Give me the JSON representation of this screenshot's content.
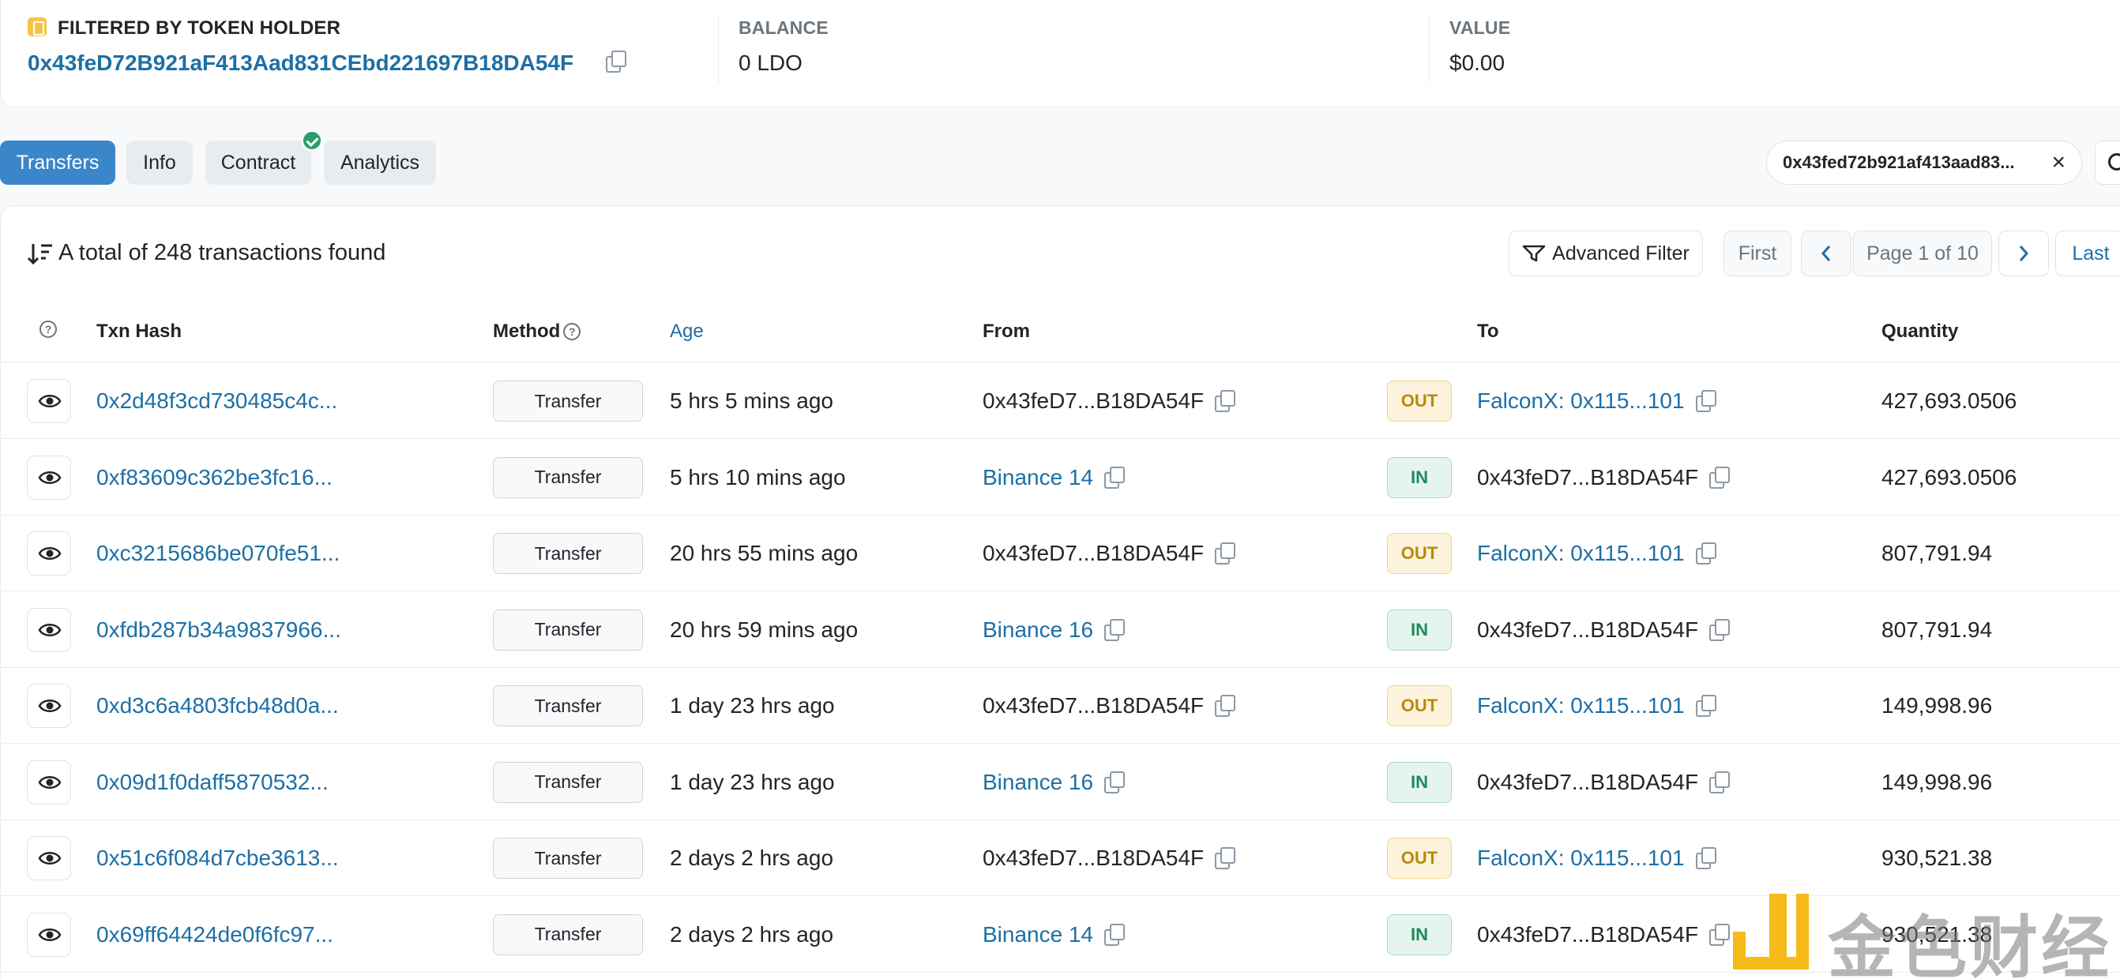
{
  "summary": {
    "filter_label": "FILTERED BY TOKEN HOLDER",
    "holder_address": "0x43feD72B921aF413Aad831CEbd221697B18DA54F",
    "balance_label": "BALANCE",
    "balance_value": "0 LDO",
    "value_label": "VALUE",
    "value_value": "$0.00"
  },
  "tabs": [
    {
      "label": "Transfers",
      "active": true
    },
    {
      "label": "Info",
      "active": false
    },
    {
      "label": "Contract",
      "active": false,
      "verified": true
    },
    {
      "label": "Analytics",
      "active": false
    }
  ],
  "filter_chip": {
    "text": "0x43fed72b921af413aad83..."
  },
  "toolbar": {
    "total_text": "A total of 248 transactions found",
    "advanced_filter_label": "Advanced Filter",
    "pagination": {
      "first": "First",
      "page_text": "Page 1 of 10",
      "last": "Last"
    }
  },
  "table": {
    "headers": {
      "txn_hash": "Txn Hash",
      "method": "Method",
      "age": "Age",
      "from": "From",
      "to": "To",
      "quantity": "Quantity"
    },
    "rows": [
      {
        "hash": "0x2d48f3cd730485c4c...",
        "method": "Transfer",
        "age": "5 hrs 5 mins ago",
        "from": "0x43feD7...B18DA54F",
        "from_link": false,
        "direction": "OUT",
        "to": "FalconX: 0x115...101",
        "to_link": true,
        "quantity": "427,693.0506"
      },
      {
        "hash": "0xf83609c362be3fc16...",
        "method": "Transfer",
        "age": "5 hrs 10 mins ago",
        "from": "Binance 14",
        "from_link": true,
        "direction": "IN",
        "to": "0x43feD7...B18DA54F",
        "to_link": false,
        "quantity": "427,693.0506"
      },
      {
        "hash": "0xc3215686be070fe51...",
        "method": "Transfer",
        "age": "20 hrs 55 mins ago",
        "from": "0x43feD7...B18DA54F",
        "from_link": false,
        "direction": "OUT",
        "to": "FalconX: 0x115...101",
        "to_link": true,
        "quantity": "807,791.94"
      },
      {
        "hash": "0xfdb287b34a9837966...",
        "method": "Transfer",
        "age": "20 hrs 59 mins ago",
        "from": "Binance 16",
        "from_link": true,
        "direction": "IN",
        "to": "0x43feD7...B18DA54F",
        "to_link": false,
        "quantity": "807,791.94"
      },
      {
        "hash": "0xd3c6a4803fcb48d0a...",
        "method": "Transfer",
        "age": "1 day 23 hrs ago",
        "from": "0x43feD7...B18DA54F",
        "from_link": false,
        "direction": "OUT",
        "to": "FalconX: 0x115...101",
        "to_link": true,
        "quantity": "149,998.96"
      },
      {
        "hash": "0x09d1f0daff5870532...",
        "method": "Transfer",
        "age": "1 day 23 hrs ago",
        "from": "Binance 16",
        "from_link": true,
        "direction": "IN",
        "to": "0x43feD7...B18DA54F",
        "to_link": false,
        "quantity": "149,998.96"
      },
      {
        "hash": "0x51c6f084d7cbe3613...",
        "method": "Transfer",
        "age": "2 days 2 hrs ago",
        "from": "0x43feD7...B18DA54F",
        "from_link": false,
        "direction": "OUT",
        "to": "FalconX: 0x115...101",
        "to_link": true,
        "quantity": "930,521.38"
      },
      {
        "hash": "0x69ff64424de0f6fc97...",
        "method": "Transfer",
        "age": "2 days 2 hrs ago",
        "from": "Binance 14",
        "from_link": true,
        "direction": "IN",
        "to": "0x43feD7...B18DA54F",
        "to_link": false,
        "quantity": "930,521.38"
      }
    ]
  },
  "watermark": {
    "text": "金色财经"
  },
  "colors": {
    "accent": "#3a86c8",
    "link": "#1d6fa5",
    "out_badge": "#b88a07",
    "in_badge": "#1e8a5c"
  }
}
